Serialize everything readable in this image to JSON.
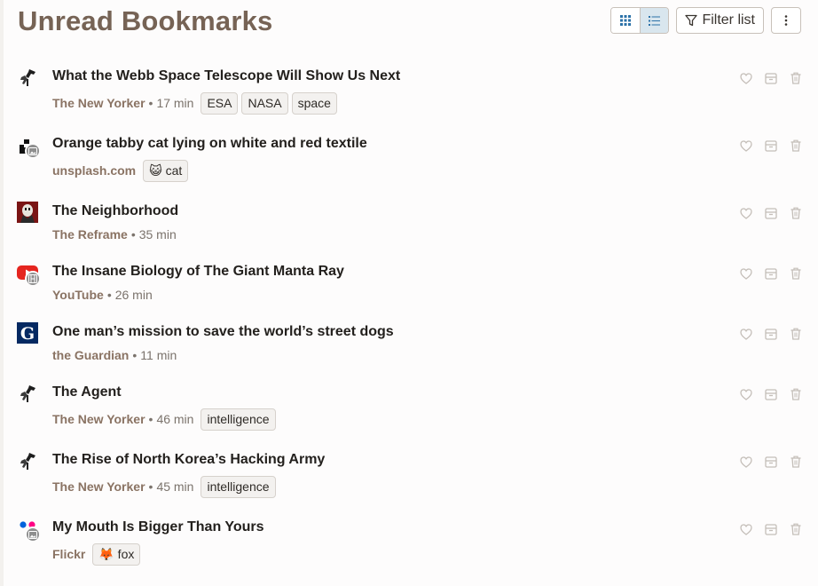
{
  "header": {
    "title": "Unread Bookmarks",
    "grid_view_icon": "grid-icon",
    "list_view_icon": "list-icon",
    "filter_label": "Filter list",
    "filter_icon": "filter-icon",
    "more_icon": "kebab-menu-icon"
  },
  "colors": {
    "title": "#766355",
    "site": "#8a7363",
    "active_view": "#d9e6ee",
    "action_icons": "#c4beb8"
  },
  "bookmarks": [
    {
      "title": "What the Webb Space Telescope Will Show Us Next",
      "site": "The New Yorker",
      "separator": "•",
      "duration": "17 min",
      "tags": [
        "ESA",
        "NASA",
        "space"
      ],
      "favicon": "new-yorker-favicon"
    },
    {
      "title": "Orange tabby cat lying on white and red textile",
      "site": "unsplash.com",
      "separator": "",
      "duration": "",
      "tags": [
        "😺 cat"
      ],
      "favicon": "unsplash-favicon",
      "badge": "image-badge-icon"
    },
    {
      "title": "The Neighborhood",
      "site": "The Reframe",
      "separator": "•",
      "duration": "35 min",
      "tags": [],
      "favicon": "reframe-favicon"
    },
    {
      "title": "The Insane Biology of The Giant Manta Ray",
      "site": "YouTube",
      "separator": "•",
      "duration": "26 min",
      "tags": [],
      "favicon": "youtube-favicon",
      "badge": "video-badge-icon"
    },
    {
      "title": "One man’s mission to save the world’s street dogs",
      "site": "the Guardian",
      "separator": "•",
      "duration": "11 min",
      "tags": [],
      "favicon": "guardian-favicon"
    },
    {
      "title": "The Agent",
      "site": "The New Yorker",
      "separator": "•",
      "duration": "46 min",
      "tags": [
        "intelligence"
      ],
      "favicon": "new-yorker-favicon"
    },
    {
      "title": "The Rise of North Korea’s Hacking Army",
      "site": "The New Yorker",
      "separator": "•",
      "duration": "45 min",
      "tags": [
        "intelligence"
      ],
      "favicon": "new-yorker-favicon"
    },
    {
      "title": "My Mouth Is Bigger Than Yours",
      "site": "Flickr",
      "separator": "",
      "duration": "",
      "tags": [
        "🦊 fox"
      ],
      "favicon": "flickr-favicon",
      "badge": "image-badge-icon"
    }
  ],
  "item_actions": [
    "heart-icon",
    "archive-icon",
    "trash-icon"
  ]
}
